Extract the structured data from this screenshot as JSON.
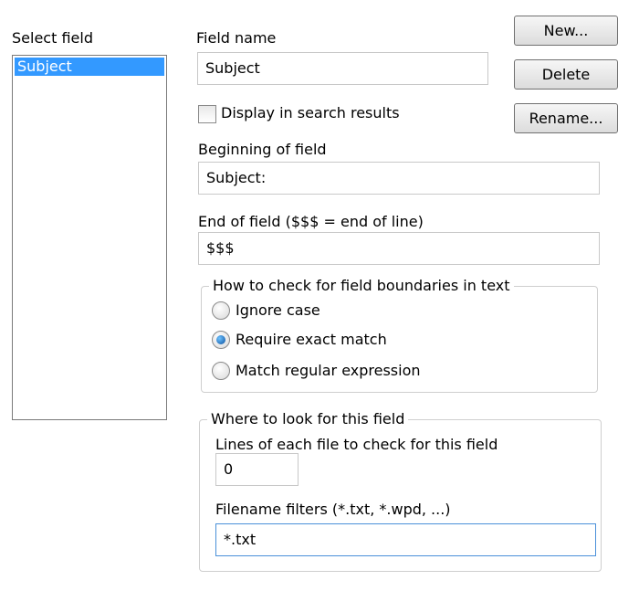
{
  "left_panel": {
    "label": "Select field",
    "items": [
      "Subject"
    ]
  },
  "buttons": {
    "new": "New...",
    "delete": "Delete",
    "rename": "Rename..."
  },
  "field_name": {
    "label": "Field name",
    "value": "Subject"
  },
  "display_in_results": {
    "label": "Display in search results",
    "checked": false
  },
  "beginning": {
    "label": "Beginning of field",
    "value": "Subject:"
  },
  "end": {
    "label": "End of field ($$$ = end of line)",
    "value": "$$$"
  },
  "boundaries": {
    "legend": "How to check for field boundaries in text",
    "options": [
      "Ignore case",
      "Require exact match",
      "Match regular expression"
    ],
    "selected": "Require exact match"
  },
  "where": {
    "legend": "Where to look for this field",
    "lines_label": "Lines of each file to check for this field",
    "lines_value": "0",
    "filters_label": "Filename filters (*.txt, *.wpd, ...)",
    "filters_value": "*.txt"
  },
  "colors": {
    "selection": "#3399ff",
    "focus_border": "#4a90d9"
  }
}
